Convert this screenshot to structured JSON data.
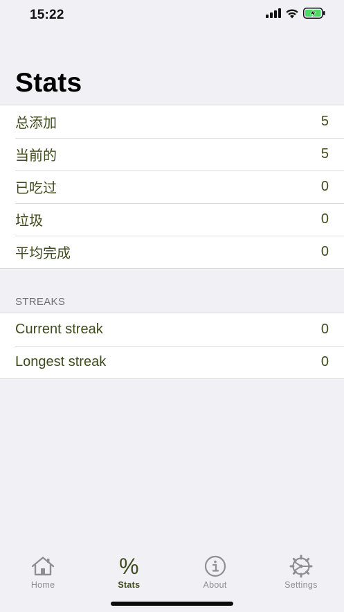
{
  "status_bar": {
    "time": "15:22",
    "icons": [
      "signal-icon",
      "wifi-icon",
      "battery-charging-icon"
    ]
  },
  "page": {
    "title": "Stats"
  },
  "stats": {
    "rows": [
      {
        "label": "总添加",
        "value": "5"
      },
      {
        "label": "当前的",
        "value": "5"
      },
      {
        "label": "已吃过",
        "value": "0"
      },
      {
        "label": "垃圾",
        "value": "0"
      },
      {
        "label": "平均完成",
        "value": "0"
      }
    ]
  },
  "streaks": {
    "header": "STREAKS",
    "rows": [
      {
        "label": "Current streak",
        "value": "0"
      },
      {
        "label": "Longest streak",
        "value": "0"
      }
    ]
  },
  "tab_bar": {
    "tabs": [
      {
        "label": "Home",
        "icon": "home-icon",
        "active": false
      },
      {
        "label": "Stats",
        "icon": "percent-icon",
        "active": true,
        "glyph": "%"
      },
      {
        "label": "About",
        "icon": "info-icon",
        "active": false
      },
      {
        "label": "Settings",
        "icon": "gear-icon",
        "active": false
      }
    ]
  },
  "colors": {
    "accent": "#3e4b1b",
    "inactive": "#8e8e93",
    "background": "#f0f0f5",
    "battery_fill": "#4cd964"
  }
}
